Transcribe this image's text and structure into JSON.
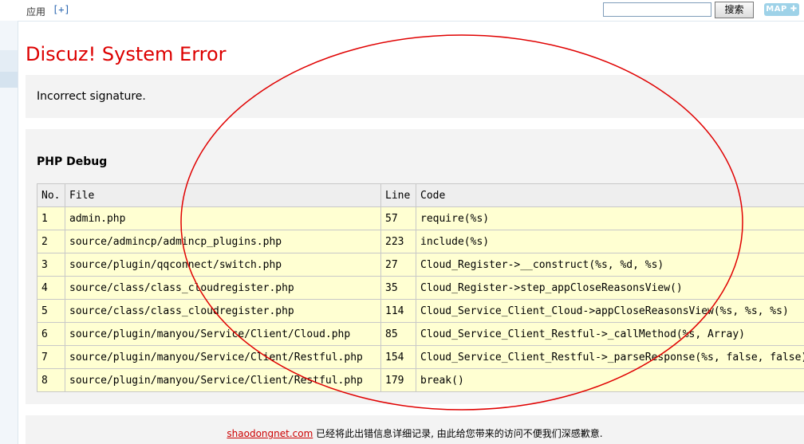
{
  "topbar": {
    "menu_label": "应用",
    "add_link": "[+]",
    "search_value": "",
    "search_button": "搜索",
    "map_button": "MAP ✚"
  },
  "error": {
    "title": "Discuz! System Error",
    "message": "Incorrect signature."
  },
  "debug": {
    "title": "PHP Debug",
    "columns": [
      "No.",
      "File",
      "Line",
      "Code"
    ],
    "rows": [
      [
        "1",
        "admin.php",
        "57",
        "require(%s)"
      ],
      [
        "2",
        "source/admincp/admincp_plugins.php",
        "223",
        "include(%s)"
      ],
      [
        "3",
        "source/plugin/qqconnect/switch.php",
        "27",
        "Cloud_Register->__construct(%s, %d, %s)"
      ],
      [
        "4",
        "source/class/class_cloudregister.php",
        "35",
        "Cloud_Register->step_appCloseReasonsView()"
      ],
      [
        "5",
        "source/class/class_cloudregister.php",
        "114",
        "Cloud_Service_Client_Cloud->appCloseReasonsView(%s, %s, %s)"
      ],
      [
        "6",
        "source/plugin/manyou/Service/Client/Cloud.php",
        "85",
        "Cloud_Service_Client_Restful->_callMethod(%s, Array)"
      ],
      [
        "7",
        "source/plugin/manyou/Service/Client/Restful.php",
        "154",
        "Cloud_Service_Client_Restful->_parseResponse(%s, false, false)"
      ],
      [
        "8",
        "source/plugin/manyou/Service/Client/Restful.php",
        "179",
        "break()"
      ]
    ]
  },
  "footer": {
    "site": "shaodongnet.com",
    "text": " 已经将此出错信息详细记录, 由此给您带来的访问不便我们深感歉意."
  },
  "colors": {
    "title_red": "#dd0000",
    "annotation_red": "#e00000",
    "row_yellow": "#ffffd2",
    "box_gray": "#f3f3f3"
  }
}
